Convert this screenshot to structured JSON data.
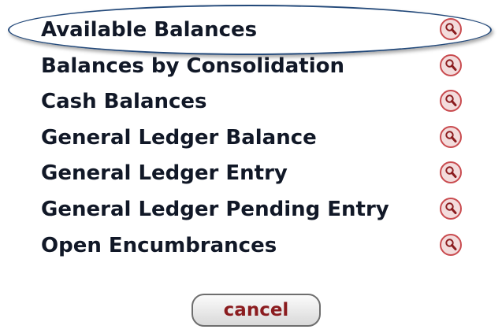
{
  "lookups": {
    "items": [
      {
        "label": "Available Balances",
        "icon": "magnifier-icon"
      },
      {
        "label": "Balances by Consolidation",
        "icon": "magnifier-icon"
      },
      {
        "label": "Cash Balances",
        "icon": "magnifier-icon"
      },
      {
        "label": "General Ledger Balance",
        "icon": "magnifier-icon"
      },
      {
        "label": "General Ledger Entry",
        "icon": "magnifier-icon"
      },
      {
        "label": "General Ledger Pending Entry",
        "icon": "magnifier-icon"
      },
      {
        "label": "Open Encumbrances",
        "icon": "magnifier-icon"
      }
    ],
    "highlighted_item": "Available Balances"
  },
  "actions": {
    "cancel_label": "cancel"
  },
  "colors": {
    "link_text": "#111827",
    "highlight_ring": "#23497a",
    "icon_fill": "#f3dcdc",
    "icon_ring": "#c94b4f",
    "icon_glyph": "#8b1c1f",
    "cancel_text": "#8b1c1f"
  }
}
